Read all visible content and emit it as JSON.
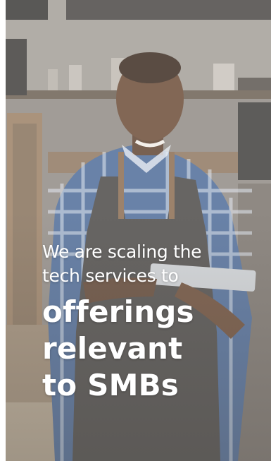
{
  "hero": {
    "headline_lines": [
      "We are scaling the",
      "tech services to"
    ],
    "emphasis_lines": [
      "offerings",
      "relevant",
      "to SMBs"
    ],
    "image_icon": "hero-photo-barista-with-tablet"
  },
  "colors": {
    "text": "#ffffff",
    "shirt_blue": "#3f5f93",
    "apron": "#4a4744",
    "skin": "#6b4a35",
    "background_wall": "#9a948c"
  }
}
